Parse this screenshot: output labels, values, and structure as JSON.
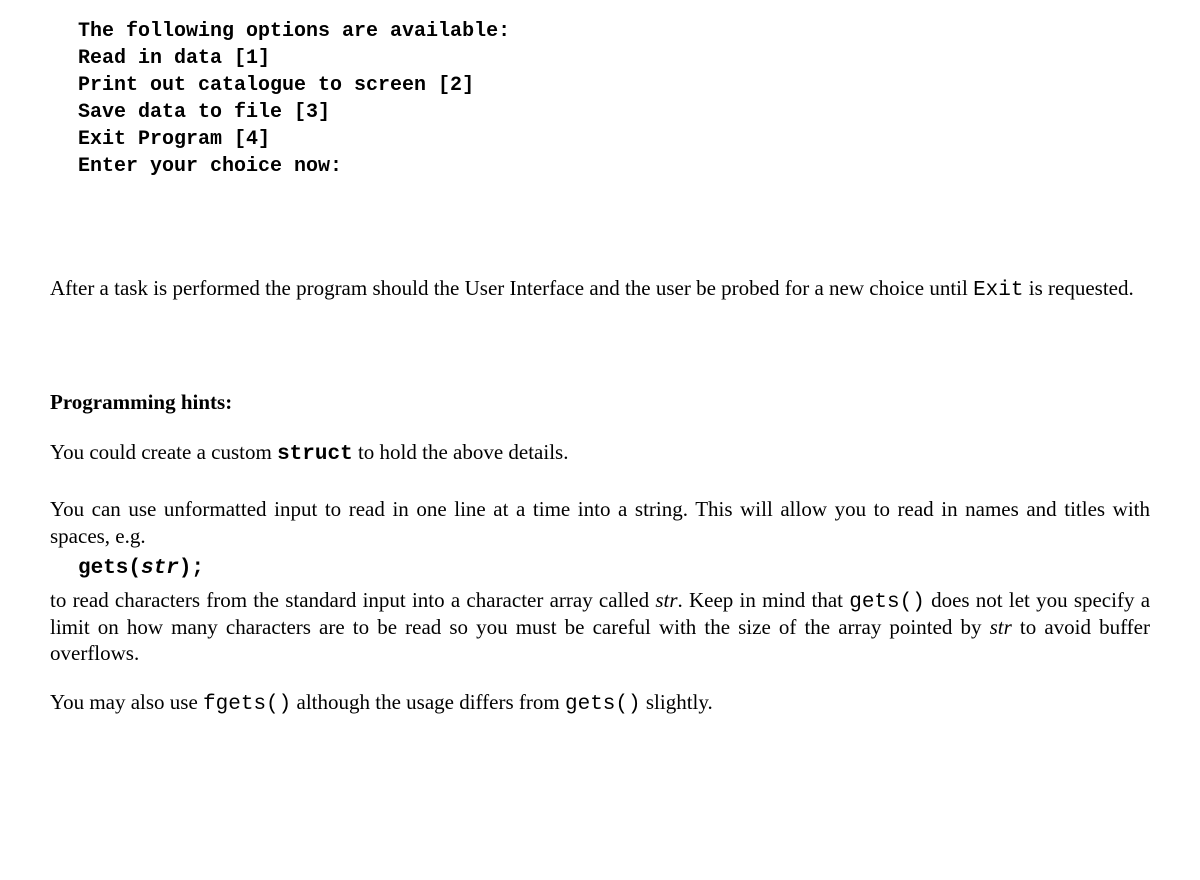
{
  "menu": {
    "title": "The following options are available:",
    "opt1": "Read in data [1]",
    "opt2": "Print out catalogue to screen [2]",
    "opt3": "Save data to file [3]",
    "opt4": "Exit Program [4]",
    "prompt": "Enter your choice now:"
  },
  "para_after1": "After a task is performed the program should the User Interface and the user be probed for a new choice until ",
  "para_after_code": "Exit",
  "para_after2": " is requested.",
  "hints_heading": "Programming hints:",
  "hint1_a": "You could create a custom ",
  "hint1_code": "struct",
  "hint1_b": " to hold the above details.",
  "hint2": "You can use unformatted input to read in one line at a time into a string. This will allow you to read in names and titles with spaces, e.g.",
  "code_gets_a": "gets(",
  "code_gets_b": "str",
  "code_gets_c": ");",
  "hint3_a": "to read characters from the standard input into a character array called ",
  "hint3_str": "str",
  "hint3_b": ". Keep in mind that ",
  "hint3_gets": "gets()",
  "hint3_c": " does not let you specify a limit on how many characters are to be read so you must be careful with the size of the array pointed by ",
  "hint3_str2": "str",
  "hint3_d": " to avoid buffer overflows.",
  "hint4_a": "You may also use ",
  "hint4_fgets": "fgets()",
  "hint4_b": " although the usage differs from ",
  "hint4_gets": "gets()",
  "hint4_c": " slightly."
}
